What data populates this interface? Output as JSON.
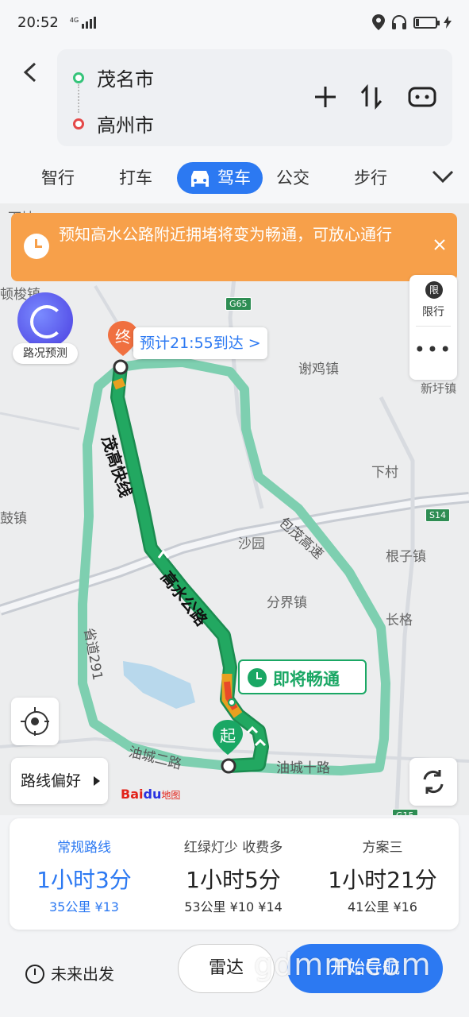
{
  "status": {
    "time": "20:52",
    "network": "4G"
  },
  "header": {
    "origin": "茂名市",
    "destination": "高州市",
    "tabs": [
      {
        "label": "智行"
      },
      {
        "label": "打车"
      },
      {
        "label": "驾车",
        "active": true
      },
      {
        "label": "公交"
      },
      {
        "label": "步行"
      }
    ]
  },
  "alert": {
    "text": "预知高水公路附近拥堵将变为畅通，可放心通行",
    "color": "#f7a04a"
  },
  "side_tools": {
    "limit_icon": "限",
    "limit_label": "限行",
    "more": "•••"
  },
  "map": {
    "predict_label": "路况预测",
    "eta": "预计21:55到达 >",
    "end_marker": "终",
    "start_marker": "起",
    "smooth_label": "即将畅通",
    "places": [
      {
        "name": "谢鸡镇"
      },
      {
        "name": "新圩镇"
      },
      {
        "name": "下村"
      },
      {
        "name": "沙园"
      },
      {
        "name": "分界镇"
      },
      {
        "name": "根子镇"
      },
      {
        "name": "长格"
      },
      {
        "name": "顿梭镇"
      },
      {
        "name": "鼓镇"
      },
      {
        "name": "下坡"
      }
    ],
    "roads": {
      "maogao": "茂高快线",
      "gaoshui": "高水公路",
      "baomao": "包茂高速",
      "sheng291": "省道291",
      "youcheng2": "油城二路",
      "youcheng10": "油城十路"
    },
    "shields": [
      "G65",
      "S14",
      "G15"
    ],
    "pref_label": "路线偏好",
    "logo_text": "Bai",
    "logo_paw": "du",
    "logo_map": "地图",
    "route_color": "#22a861",
    "alt_route_color": "#7ecfb0"
  },
  "routes": [
    {
      "title": "常规路线",
      "time": "1小时3分",
      "meta": "35公里 ¥13",
      "selected": true
    },
    {
      "title": "红绿灯少 收费多",
      "time": "1小时5分",
      "meta": "53公里 ¥10 ¥14"
    },
    {
      "title": "方案三",
      "time": "1小时21分",
      "meta": "41公里 ¥16"
    }
  ],
  "actions": {
    "future": "未来出发",
    "radar": "雷达",
    "start": "开始导航"
  },
  "watermark": "gdmm.com"
}
